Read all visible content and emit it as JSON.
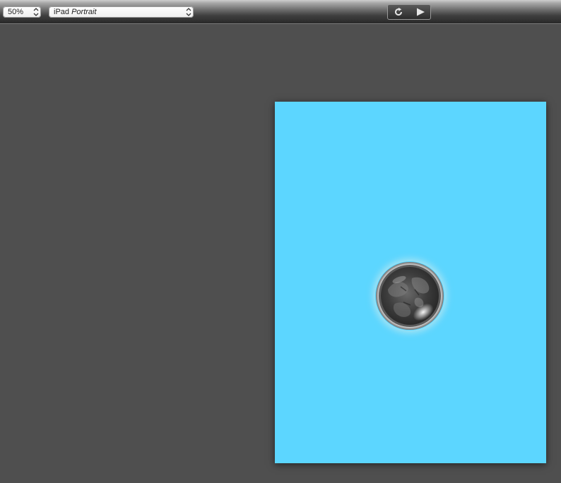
{
  "toolbar": {
    "zoom": {
      "selected": "50%",
      "icon": "stepper-arrows-icon"
    },
    "device": {
      "selected_prefix": "iPad",
      "selected_suffix": "Portrait",
      "icon": "stepper-arrows-icon"
    },
    "controls": {
      "reload_icon": "reload-icon",
      "play_icon": "play-icon"
    }
  },
  "preview": {
    "background_color": "#5cd6ff",
    "orb_icon": "moon-orb-icon"
  },
  "colors": {
    "workspace": "#4f4f4f",
    "canvas": "#5cd6ff",
    "toolbar_icon": "#e6e6e6"
  }
}
